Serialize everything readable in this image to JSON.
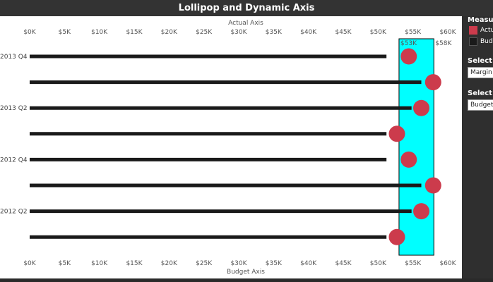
{
  "title": "Lollipop and Dynamic Axis",
  "chart_data": {
    "type": "lollipop",
    "top_axis_label": "Actual Axis",
    "bottom_axis_label": "Budget Axis",
    "x_ticks": [
      "$0K",
      "$5K",
      "$10K",
      "$15K",
      "$20K",
      "$25K",
      "$30K",
      "$35K",
      "$40K",
      "$45K",
      "$50K",
      "$55K",
      "$60K"
    ],
    "xlim": [
      0,
      60000
    ],
    "row_labels": [
      "2013 Q4",
      "",
      "2013 Q2",
      "",
      "2012 Q4",
      "",
      "2012 Q2",
      ""
    ],
    "budget_values": [
      51200,
      56200,
      54800,
      51200,
      51200,
      56200,
      54800,
      51200
    ],
    "actual_values": [
      54400,
      57900,
      56200,
      52700,
      54400,
      57900,
      56200,
      52700
    ],
    "band": {
      "start": 53000,
      "end": 58000,
      "start_label": "$53K",
      "end_label": "$58K",
      "color": "#00ffff"
    },
    "colors": {
      "actual": "#cc3b4c",
      "budget": "#1a1a1a"
    }
  },
  "legend": {
    "title": "Measure",
    "items": [
      {
        "label": "Actual",
        "color": "#cc3b4c"
      },
      {
        "label": "Budget",
        "color": "#1a1a1a"
      }
    ]
  },
  "controls": {
    "select_a": {
      "title": "Select A",
      "value": "Margin"
    },
    "select_b": {
      "title": "Select B",
      "value": "Budget F"
    }
  }
}
